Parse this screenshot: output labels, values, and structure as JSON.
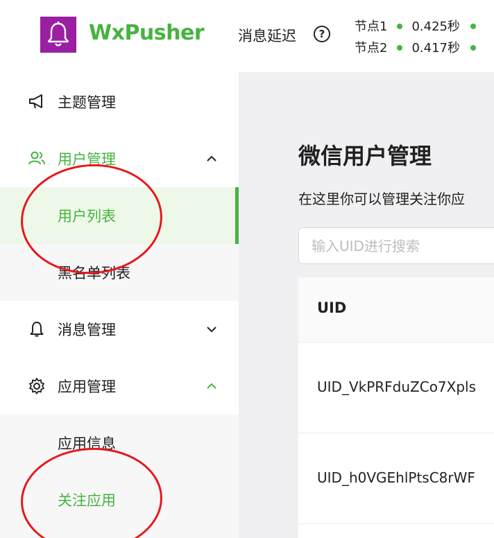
{
  "header": {
    "app_name": "WxPusher",
    "delay_label": "消息延迟",
    "help_icon": "question-circle-icon",
    "nodes": [
      {
        "name": "节点1",
        "latency": "0.425秒",
        "status_color": "#46b33f"
      },
      {
        "name": "节点2",
        "latency": "0.417秒",
        "status_color": "#46b33f"
      }
    ]
  },
  "sidebar": {
    "items": [
      {
        "label": "主题管理",
        "icon": "megaphone-icon"
      },
      {
        "label": "用户管理",
        "icon": "user-group-icon",
        "expanded": true,
        "chevron": "chevron-up-icon",
        "children": [
          {
            "label": "用户列表",
            "active": true
          },
          {
            "label": "黑名单列表"
          }
        ]
      },
      {
        "label": "消息管理",
        "icon": "bell-icon",
        "expanded": false,
        "chevron": "chevron-down-icon"
      },
      {
        "label": "应用管理",
        "icon": "gear-icon",
        "expanded": true,
        "chevron": "chevron-up-icon",
        "children": [
          {
            "label": "应用信息"
          },
          {
            "label": "关注应用"
          }
        ]
      }
    ]
  },
  "main": {
    "title": "微信用户管理",
    "description": "在这里你可以管理关注你应",
    "search_placeholder": "输入UID进行搜索",
    "table": {
      "columns": [
        "UID"
      ],
      "rows": [
        {
          "uid": "UID_VkPRFduZCo7Xpls"
        },
        {
          "uid": "UID_h0VGEhlPtsC8rWF"
        }
      ]
    }
  },
  "colors": {
    "accent": "#46b33f",
    "logo_bg": "#9a1fa3",
    "annotation": "#e8171b"
  }
}
